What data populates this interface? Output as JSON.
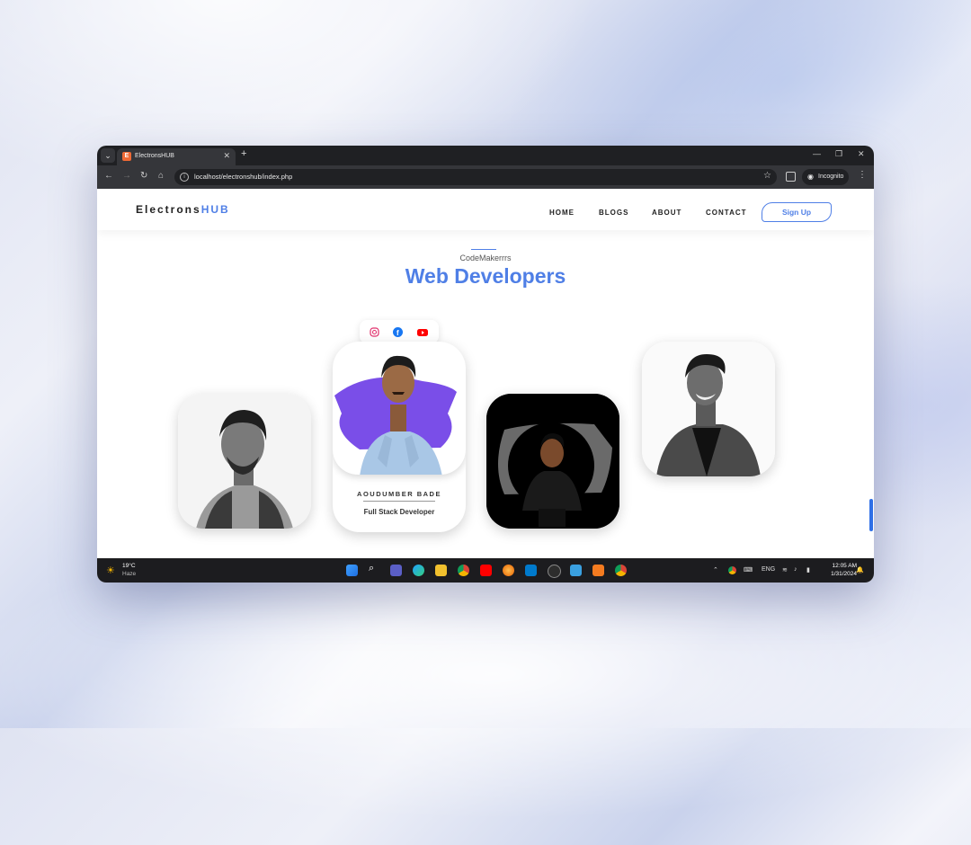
{
  "browser": {
    "tab_title": "ElectronsHUB",
    "favicon_letter": "E",
    "url": "localhost/electronshub/index.php",
    "incognito_label": "Incognito"
  },
  "site": {
    "brand_prefix": "Electrons",
    "brand_suffix": "HUB",
    "nav": [
      "HOME",
      "BLOGS",
      "ABOUT",
      "CONTACT"
    ],
    "signup_label": "Sign Up",
    "accent_color": "#4f7fe6"
  },
  "section": {
    "kicker": "CodeMakerrrs",
    "title": "Web Developers"
  },
  "developers": [
    {
      "name": "AOUDUMBER BADE",
      "role": "Full Stack Developer"
    }
  ],
  "social_icons": [
    "instagram-icon",
    "facebook-icon",
    "youtube-icon"
  ],
  "taskbar": {
    "temperature": "19°C",
    "weather": "Haze",
    "language": "ENG",
    "time": "12:05 AM",
    "date": "1/31/2024"
  }
}
